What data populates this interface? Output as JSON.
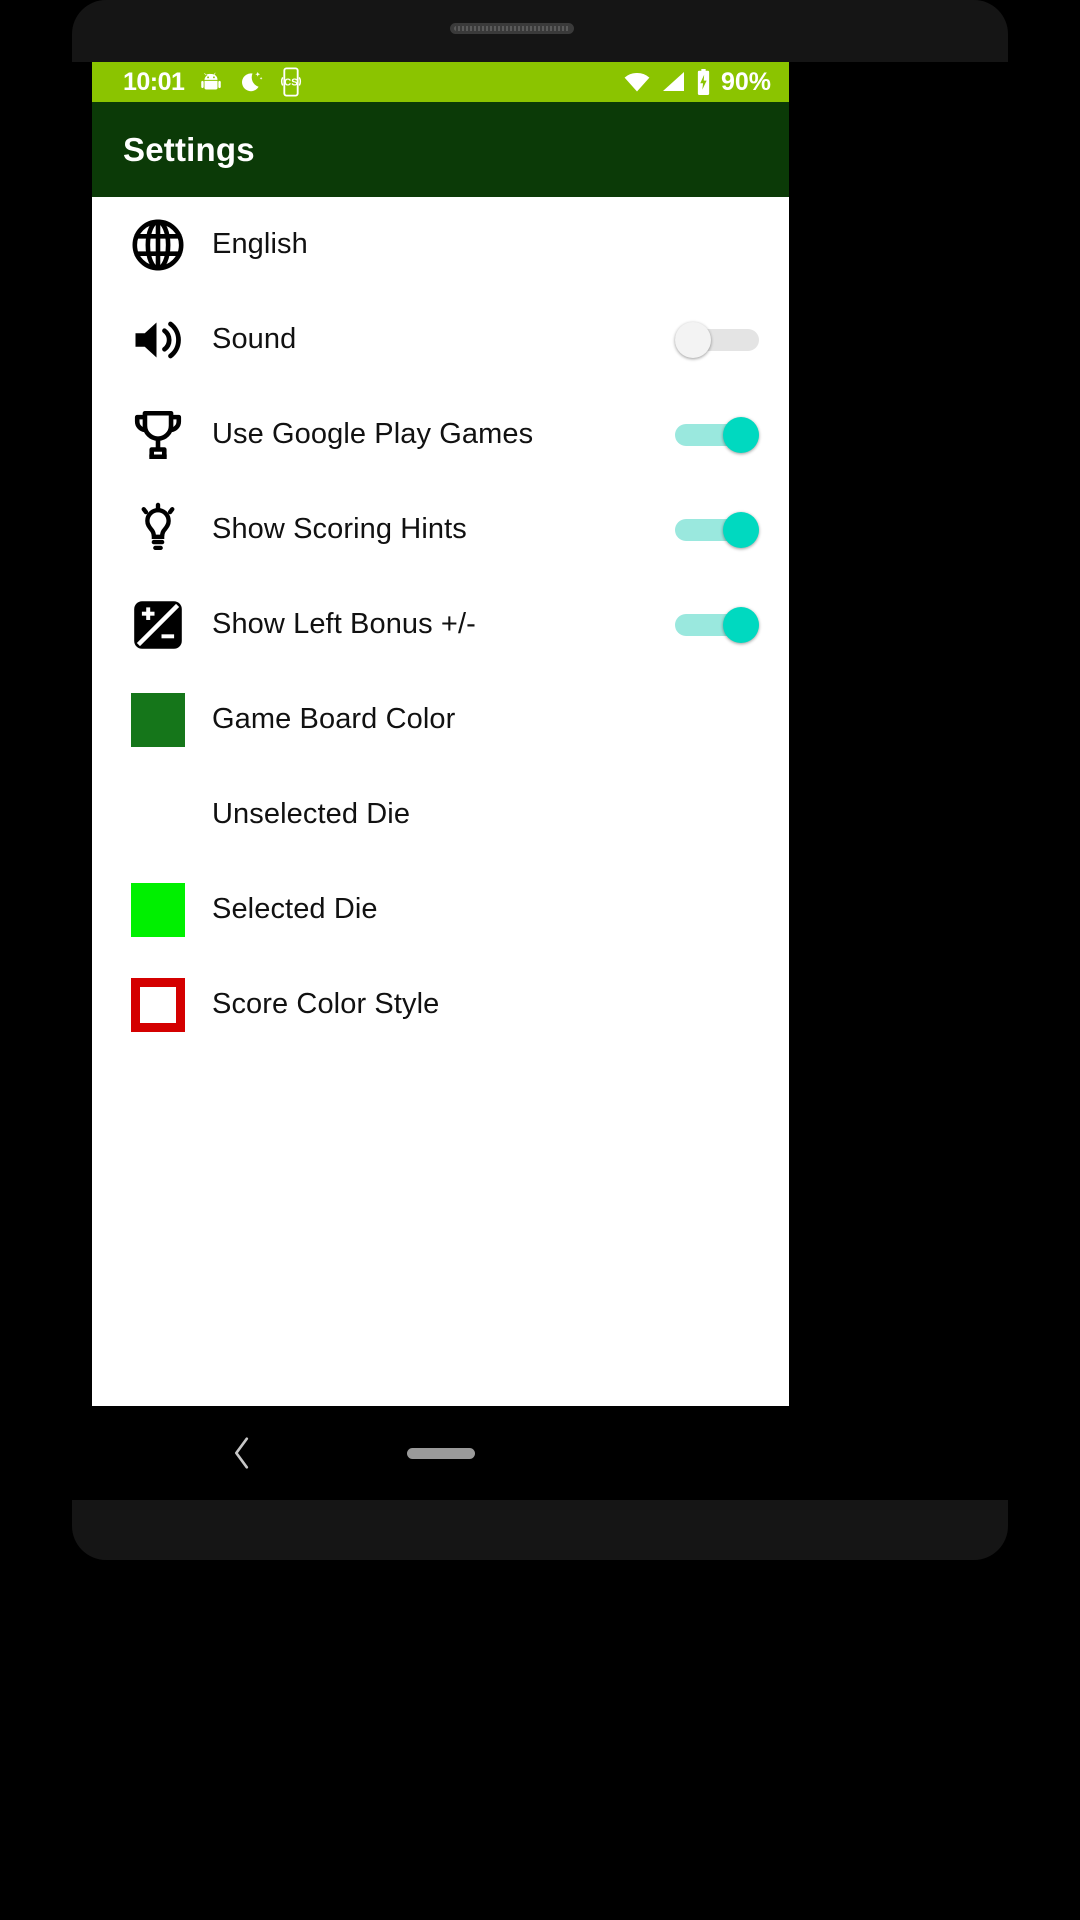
{
  "colors": {
    "status_bar_bg": "#8BC400",
    "app_bar_bg": "#0B3A07",
    "content_bg": "#FFFFFF",
    "switch_on_thumb": "#00D9C0",
    "switch_on_track": "#9AE8DE",
    "switch_off_thumb": "#F3F3F3",
    "switch_off_track": "#E4E4E4",
    "game_board_color": "#15761A",
    "unselected_die_color": "#FFFFFF",
    "selected_die_color": "#00F000",
    "score_color_style_color": "#D40000"
  },
  "status_bar": {
    "clock": "10:01",
    "battery_percent": "90%",
    "left_icons": [
      "android-robot-icon",
      "bedtime-moon-icon",
      "phone-cs-icon"
    ],
    "right_icons": [
      "wifi-icon",
      "cell-signal-icon",
      "battery-icon"
    ]
  },
  "app_bar": {
    "title": "Settings"
  },
  "settings": {
    "items": [
      {
        "label": "English",
        "icon": "globe-icon",
        "control": "none"
      },
      {
        "label": "Sound",
        "icon": "speaker-icon",
        "control": "switch",
        "value": "off"
      },
      {
        "label": "Use Google Play Games",
        "icon": "trophy-icon",
        "control": "switch",
        "value": "on"
      },
      {
        "label": "Show Scoring Hints",
        "icon": "lightbulb-icon",
        "control": "switch",
        "value": "on"
      },
      {
        "label": "Show Left Bonus +/-",
        "icon": "exposure-icon",
        "control": "switch",
        "value": "on"
      },
      {
        "label": "Game Board Color",
        "icon": "color-swatch",
        "control": "none",
        "swatch": "#15761A"
      },
      {
        "label": "Unselected Die",
        "icon": "color-swatch",
        "control": "none",
        "swatch": "#FFFFFF"
      },
      {
        "label": "Selected Die",
        "icon": "color-swatch",
        "control": "none",
        "swatch": "#00F000"
      },
      {
        "label": "Score Color Style",
        "icon": "color-outline-swatch",
        "control": "none",
        "swatch": "#D40000"
      }
    ]
  },
  "nav_bar": {
    "back_label": "Back",
    "home_pill_label": "Home"
  }
}
